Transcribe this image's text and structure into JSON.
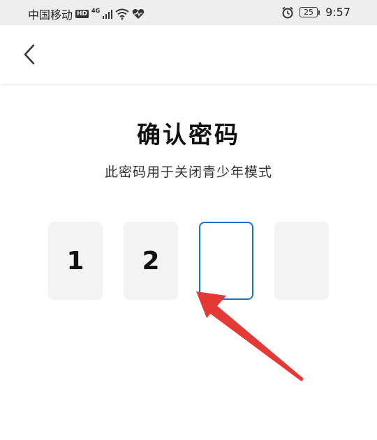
{
  "status_bar": {
    "carrier": "中国移动",
    "hd": "HD",
    "network": "4G",
    "battery": "25",
    "time": "9:57"
  },
  "nav": {
    "back_icon": "chevron-left-icon"
  },
  "title": "确认密码",
  "subtitle": "此密码用于关闭青少年模式",
  "pin": {
    "digits": [
      "1",
      "2",
      "",
      ""
    ],
    "active_index": 2
  },
  "colors": {
    "active_border": "#1f6fc9",
    "box_background": "#f3f3f3",
    "annotation_arrow": "#e53935"
  }
}
